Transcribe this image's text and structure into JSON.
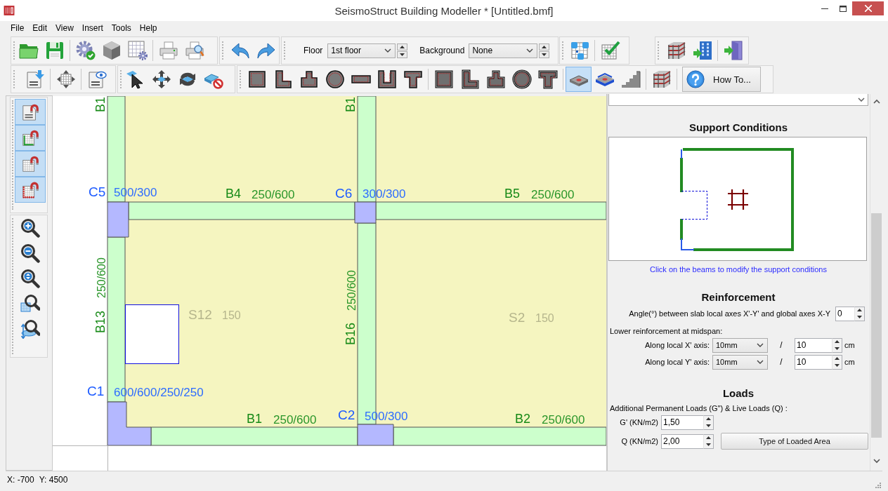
{
  "window": {
    "title": "SeismoStruct Building Modeller * [Untitled.bmf]"
  },
  "menu": [
    "File",
    "Edit",
    "View",
    "Insert",
    "Tools",
    "Help"
  ],
  "toolbar": {
    "floor": {
      "label": "Floor",
      "value": "1st floor"
    },
    "background": {
      "label": "Background",
      "value": "None"
    },
    "element_buttons": [
      {
        "selected": false
      },
      {
        "selected": false
      },
      {
        "selected": false
      },
      {
        "selected": false
      },
      {
        "selected": false
      },
      {
        "selected": false
      },
      {
        "selected": false
      },
      {
        "selected": false
      },
      {
        "selected": false
      },
      {
        "selected": false
      },
      {
        "selected": false
      },
      {
        "selected": false
      },
      {
        "selected": true
      },
      {
        "selected": false
      },
      {
        "selected": false
      }
    ],
    "how_to_button": "How To..."
  },
  "snap_buttons": [
    {
      "checked": true
    },
    {
      "checked": true
    },
    {
      "checked": true
    },
    {
      "checked": true
    }
  ],
  "plan": {
    "beams": [
      {
        "name": "B1"
      },
      {
        "name": "B1"
      },
      {
        "name": "B4",
        "section": "250/600"
      },
      {
        "name": "B5",
        "section": "250/600"
      },
      {
        "name": "B13",
        "section": "250/600"
      },
      {
        "name": "B16",
        "section": "250/600"
      },
      {
        "name": "B1",
        "section": "250/600"
      },
      {
        "name": "B2",
        "section": "250/600"
      }
    ],
    "columns": [
      {
        "name": "C5",
        "section": "500/300"
      },
      {
        "name": "C6",
        "section": "300/300"
      },
      {
        "name": "C1",
        "section": "600/600/250/250"
      },
      {
        "name": "C2",
        "section": "500/300"
      }
    ],
    "slabs": [
      {
        "name": "S12",
        "thickness": "150"
      },
      {
        "name": "S2",
        "thickness": "150"
      }
    ]
  },
  "properties": {
    "support_conditions": {
      "title": "Support Conditions",
      "edges": [
        {
          "supported": true
        },
        {
          "supported": true
        },
        {
          "supported": true
        },
        {
          "supported": true
        },
        {
          "supported": true
        },
        {
          "supported": false
        },
        {
          "supported": false
        }
      ],
      "hint": "Click on the beams to modify the support conditions"
    },
    "reinforcement": {
      "title": "Reinforcement",
      "angle_label": "Angle(°) between slab local axes X'-Y' and global axes X-Y",
      "angle_value": "0",
      "lower_label": "Lower reinforcement at midspan:",
      "rows": [
        {
          "label": "Along local X' axis:",
          "bar": "10mm",
          "separator": "/",
          "spacing": "10",
          "unit": "cm"
        },
        {
          "label": "Along local Y' axis:",
          "bar": "10mm",
          "separator": "/",
          "spacing": "10",
          "unit": "cm"
        }
      ]
    },
    "loads": {
      "title": "Loads",
      "subtitle": "Additional Permanent Loads (G\") & Live Loads (Q) :",
      "fields": [
        {
          "label": "G' (KN/m2)",
          "value": "1,50"
        },
        {
          "label": "Q (KN/m2)",
          "value": "2,00"
        }
      ],
      "button": "Type of Loaded Area"
    }
  },
  "status_bar": {
    "x": "X: -700",
    "y": "Y: 4500"
  }
}
